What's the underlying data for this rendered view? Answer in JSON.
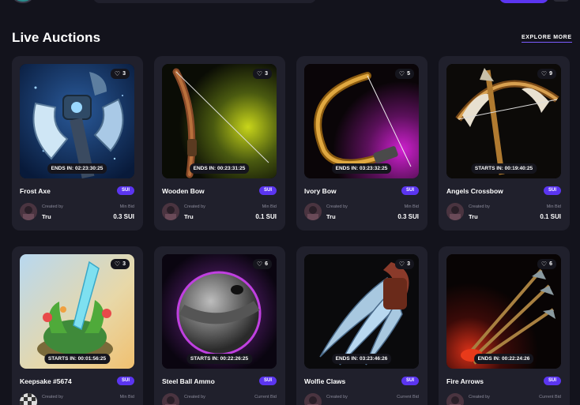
{
  "header": {
    "section_title": "Live Auctions",
    "explore_label": "EXPLORE MORE"
  },
  "cards": [
    {
      "name": "Frost Axe",
      "likes": "3",
      "timer": "ENDS IN: 02:23:30:25",
      "currency": "SUI",
      "created_label": "Created by",
      "creator": "Tru",
      "bid_label": "Min Bid",
      "bid": "0.3 SUI"
    },
    {
      "name": "Wooden Bow",
      "likes": "3",
      "timer": "ENDS IN: 00:23:31:25",
      "currency": "SUI",
      "created_label": "Created by",
      "creator": "Tru",
      "bid_label": "Min Bid",
      "bid": "0.1 SUI"
    },
    {
      "name": "Ivory Bow",
      "likes": "5",
      "timer": "ENDS IN: 03:23:32:25",
      "currency": "SUI",
      "created_label": "Created by",
      "creator": "Tru",
      "bid_label": "Min Bid",
      "bid": "0.3 SUI"
    },
    {
      "name": "Angels Crossbow",
      "likes": "9",
      "timer": "STARTS IN: 00:19:40:25",
      "currency": "SUI",
      "created_label": "Created by",
      "creator": "Tru",
      "bid_label": "Min Bid",
      "bid": "0.1 SUI"
    },
    {
      "name": "Keepsake #5674",
      "likes": "3",
      "timer": "STARTS IN: 00:01:56:25",
      "currency": "SUI",
      "created_label": "Created by",
      "creator": "",
      "bid_label": "Min Bid",
      "bid": ""
    },
    {
      "name": "Steel Ball Ammo",
      "likes": "6",
      "timer": "STARTS IN: 00:22:26:25",
      "currency": "SUI",
      "created_label": "Created by",
      "creator": "",
      "bid_label": "Current Bid",
      "bid": ""
    },
    {
      "name": "Wolfie Claws",
      "likes": "3",
      "timer": "ENDS IN: 03:23:46:26",
      "currency": "SUI",
      "created_label": "Created by",
      "creator": "",
      "bid_label": "Current Bid",
      "bid": ""
    },
    {
      "name": "Fire Arrows",
      "likes": "6",
      "timer": "ENDS IN: 00:22:24:26",
      "currency": "SUI",
      "created_label": "Created by",
      "creator": "",
      "bid_label": "Current Bid",
      "bid": ""
    }
  ],
  "colors": {
    "background": "#13131c",
    "card": "#20202c",
    "accent": "#5b35f0"
  }
}
